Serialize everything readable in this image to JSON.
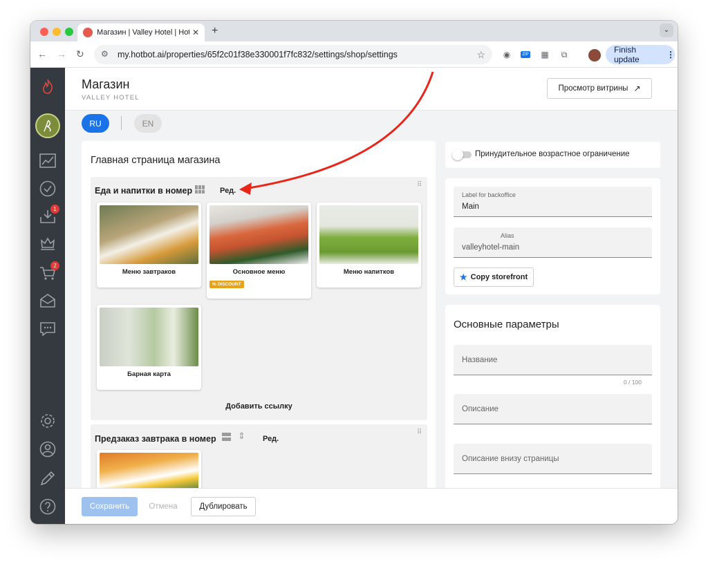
{
  "browser": {
    "tab_title": "Магазин | Valley Hotel | Hotbot",
    "url": "my.hotbot.ai/properties/65f2c01f38e330001f7fc832/settings/shop/settings",
    "finish_update": "Finish update",
    "colors": {
      "close": "#ff5f57",
      "minimize": "#febc2e",
      "maximize": "#28c840"
    }
  },
  "sidebar": {
    "items": [
      {
        "icon": "flame-icon"
      },
      {
        "icon": "logo-icon"
      },
      {
        "icon": "analytics-icon"
      },
      {
        "icon": "check-icon"
      },
      {
        "icon": "inbox-download-icon",
        "badge": "1"
      },
      {
        "icon": "crown-icon"
      },
      {
        "icon": "cart-icon",
        "badge": "2"
      },
      {
        "icon": "mail-icon"
      },
      {
        "icon": "chat-icon"
      },
      {
        "icon": "gear-icon"
      },
      {
        "icon": "user-icon"
      },
      {
        "icon": "pencil-icon"
      },
      {
        "icon": "help-icon"
      }
    ]
  },
  "header": {
    "title": "Магазин",
    "subtitle": "VALLEY HOTEL",
    "preview_button": "Просмотр витрины"
  },
  "languages": {
    "active": "RU",
    "other": "EN"
  },
  "left": {
    "title": "Главная страница магазина",
    "section1": {
      "title": "Еда и напитки в номер",
      "edit": "Ред.",
      "tiles": [
        {
          "label": "Меню завтраков"
        },
        {
          "label": "Основное меню",
          "badge": "DISCOUNT"
        },
        {
          "label": "Меню напитков"
        },
        {
          "label": "Барная карта"
        }
      ],
      "add_link": "Добавить ссылку"
    },
    "section2": {
      "title": "Предзаказ завтрака в номер",
      "edit": "Ред."
    }
  },
  "right": {
    "age_toggle_label": "Принудительное возрастное ограничение",
    "label_field": {
      "label": "Label for backoffice",
      "value": "Main"
    },
    "alias_field": {
      "label": "Alias",
      "value": "valleyhotel-main"
    },
    "copy_button": "Copy storefront",
    "params_title": "Основные параметры",
    "name_field": "Название",
    "name_counter": "0 / 100",
    "desc_field": "Описание",
    "footer_desc_field": "Описание внизу страницы"
  },
  "footer": {
    "save": "Сохранить",
    "cancel": "Отмена",
    "duplicate": "Дублировать"
  },
  "accent": "#1a73e8"
}
